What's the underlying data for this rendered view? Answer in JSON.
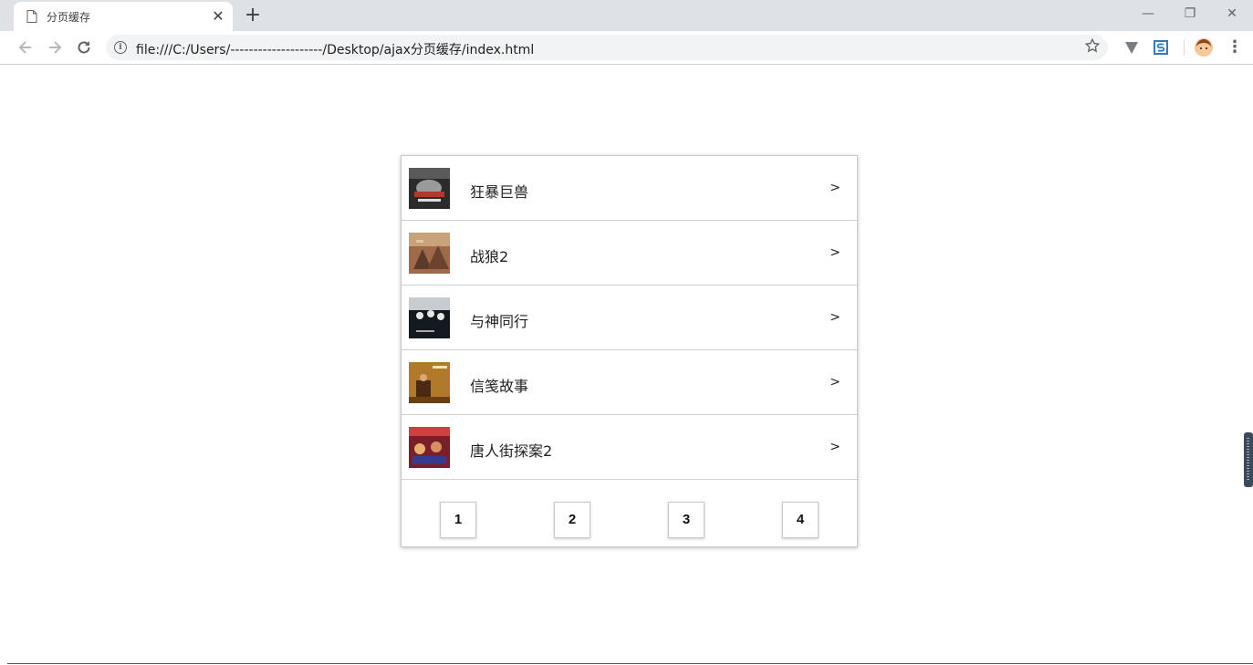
{
  "browser": {
    "tab_title": "分页缓存",
    "tab_close": "✕",
    "new_tab": "+",
    "url": "file:///C:/Users/--------------------/Desktop/ajax分页缓存/index.html",
    "window_minimize": "—",
    "window_restore": "❐",
    "window_close": "✕",
    "icons": [
      "back-icon",
      "forward-icon",
      "reload-icon",
      "info-icon",
      "star-icon",
      "vpn-extension-icon",
      "s-extension-icon",
      "avatar",
      "menu-icon"
    ]
  },
  "movies": [
    {
      "title": "狂暴巨兽",
      "arrow": ">",
      "poster_color": "#3a3a3a"
    },
    {
      "title": "战狼2",
      "arrow": ">",
      "poster_color": "#8a5a3c"
    },
    {
      "title": "与神同行",
      "arrow": ">",
      "poster_color": "#1e2a30"
    },
    {
      "title": "信笺故事",
      "arrow": ">",
      "poster_color": "#8a5a1a"
    },
    {
      "title": "唐人街探案2",
      "arrow": ">",
      "poster_color": "#9a2e2e"
    }
  ],
  "pagination": {
    "pages": [
      "1",
      "2",
      "3",
      "4"
    ]
  }
}
